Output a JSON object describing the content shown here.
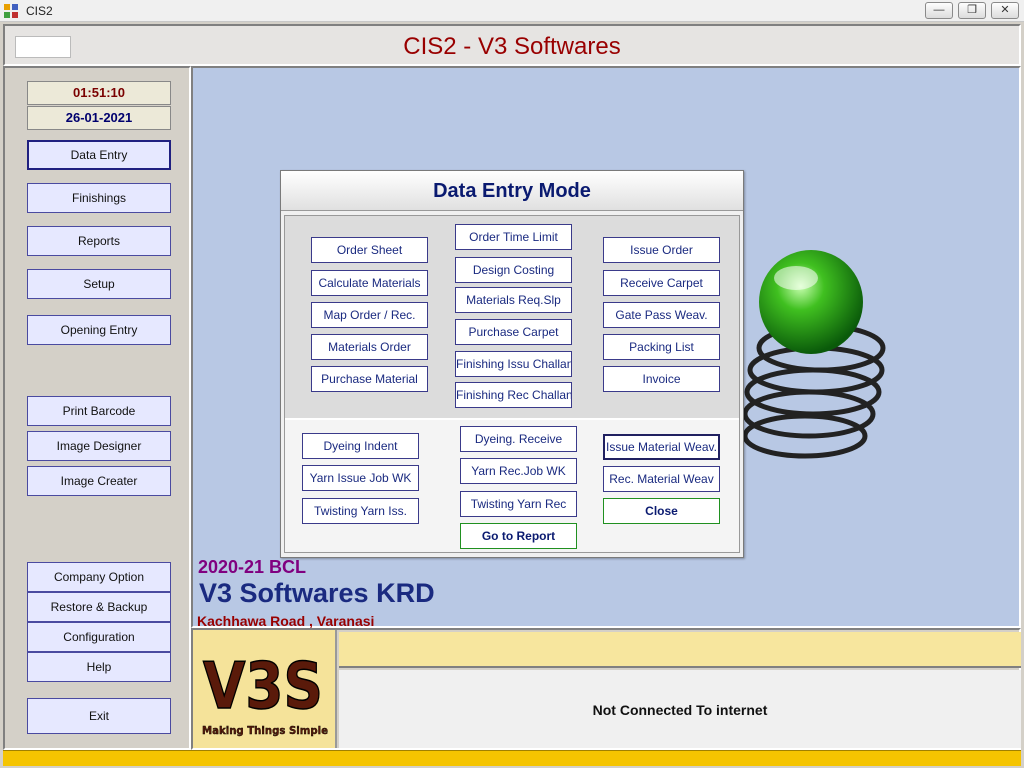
{
  "window": {
    "title": "CIS2",
    "minimize": "—",
    "restore": "❐",
    "close": "✕"
  },
  "header": {
    "app_heading": "CIS2 - V3 Softwares"
  },
  "sidebar": {
    "time": "01:51:10",
    "date": "26-01-2021",
    "items": [
      {
        "label": "Data Entry"
      },
      {
        "label": "Finishings"
      },
      {
        "label": "Reports"
      },
      {
        "label": "Setup"
      },
      {
        "label": "Opening Entry"
      },
      {
        "label": "Print Barcode"
      },
      {
        "label": "Image Designer"
      },
      {
        "label": "Image Creater"
      },
      {
        "label": "Company Option"
      },
      {
        "label": "Restore & Backup"
      },
      {
        "label": "Configuration"
      },
      {
        "label": "Help"
      },
      {
        "label": "Exit"
      }
    ]
  },
  "main": {
    "financial_year": "2020-21 BCL",
    "company_name": "V3 Softwares KRD",
    "company_address": "Kachhawa Road , Varanasi"
  },
  "dialog": {
    "title": "Data Entry Mode",
    "top_buttons": [
      "Order Sheet",
      "Calculate Materials",
      "Map Order / Rec.",
      "Materials Order",
      "Purchase Material",
      "Order Time Limit",
      "Design Costing",
      "Materials Req.Slp",
      "Purchase Carpet",
      "Finishing Issu Challan",
      "Finishing Rec Challan",
      "Issue Order",
      "Receive Carpet",
      "Gate Pass Weav.",
      "Packing List",
      "Invoice"
    ],
    "bottom_buttons": [
      "Dyeing Indent",
      "Yarn Issue Job WK",
      "Twisting Yarn Iss.",
      "Dyeing. Receive",
      "Yarn Rec.Job WK",
      "Twisting Yarn Rec",
      "Go to Report",
      "Issue Material Weav.",
      "Rec. Material Weav",
      "Close"
    ]
  },
  "logo": {
    "text": "V3S",
    "tagline": "Making Things Simple"
  },
  "status": {
    "connection": "Not Connected To internet"
  },
  "colors": {
    "heading": "#990000",
    "main_bg": "#b8c8e4",
    "accent_green": "#209020",
    "footer": "#f5c400"
  }
}
